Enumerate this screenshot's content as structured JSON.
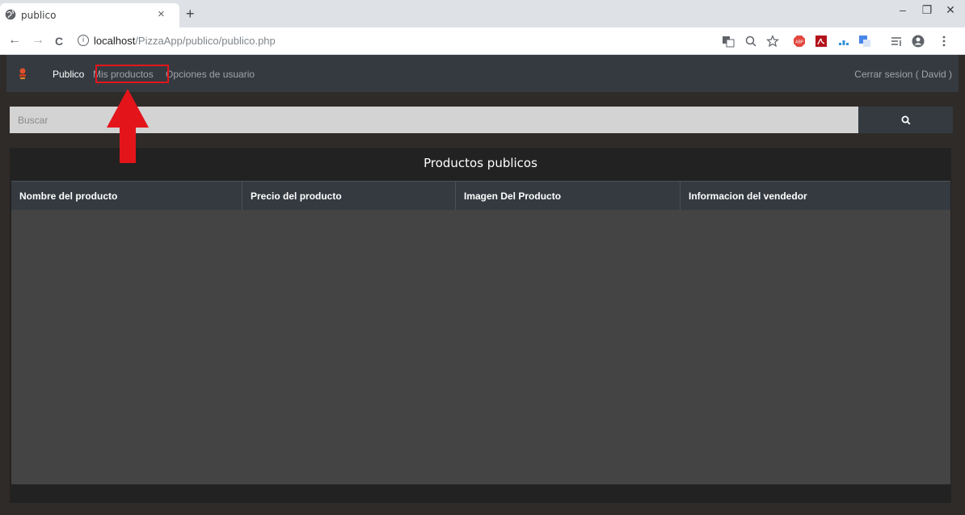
{
  "browser": {
    "tab_title": "publico",
    "tab_close": "×",
    "new_tab": "+",
    "url_host": "localhost",
    "url_path": "/PizzaApp/publico/publico.php",
    "back": "←",
    "forward": "→",
    "reload": "C",
    "minimize": "–",
    "restore": "❐",
    "close": "✕"
  },
  "navbar": {
    "links": [
      "Publico",
      "Mis productos",
      "Opciones de usuario"
    ],
    "logout": "Cerrar sesion ( David )"
  },
  "search": {
    "placeholder": "Buscar"
  },
  "panel": {
    "title": "Productos publicos",
    "columns": [
      "Nombre del producto",
      "Precio del producto",
      "Imagen Del Producto",
      "Informacion del vendedor"
    ],
    "rows": []
  },
  "colors": {
    "annotation": "#e3151b",
    "navbar": "#343a40",
    "page_bg": "#2f2b28"
  }
}
